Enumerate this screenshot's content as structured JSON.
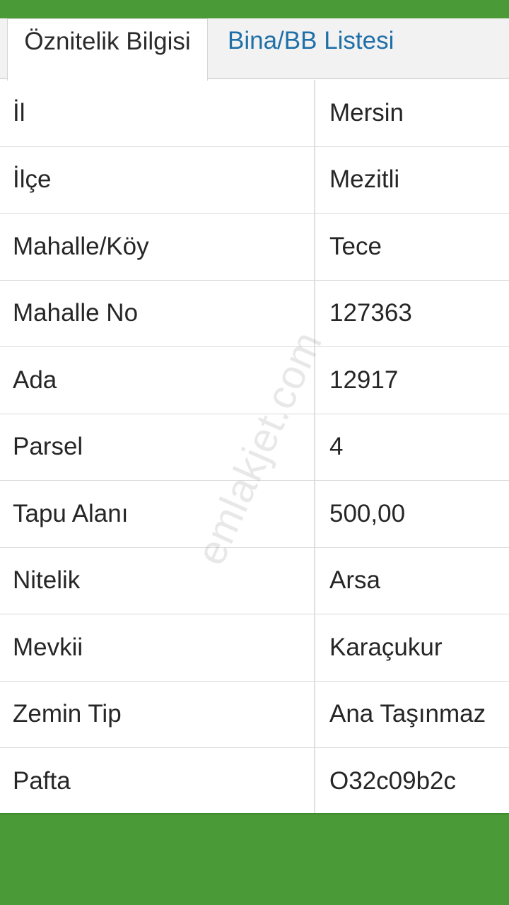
{
  "tabs": [
    {
      "label": "Öznitelik Bilgisi",
      "active": true
    },
    {
      "label": "Bina/BB Listesi",
      "active": false
    }
  ],
  "rows": [
    {
      "label": "İl",
      "value": "Mersin"
    },
    {
      "label": "İlçe",
      "value": "Mezitli"
    },
    {
      "label": "Mahalle/Köy",
      "value": "Tece"
    },
    {
      "label": "Mahalle No",
      "value": "127363"
    },
    {
      "label": "Ada",
      "value": "12917"
    },
    {
      "label": "Parsel",
      "value": "4"
    },
    {
      "label": "Tapu Alanı",
      "value": "500,00"
    },
    {
      "label": "Nitelik",
      "value": "Arsa"
    },
    {
      "label": "Mevkii",
      "value": "Karaçukur"
    },
    {
      "label": "Zemin Tip",
      "value": "Ana Taşınmaz"
    },
    {
      "label": "Pafta",
      "value": "O32c09b2c"
    }
  ],
  "watermark": "emlakjet.com",
  "colors": {
    "bar_green": "#4b9a38",
    "tab_link": "#1f6fa8"
  }
}
